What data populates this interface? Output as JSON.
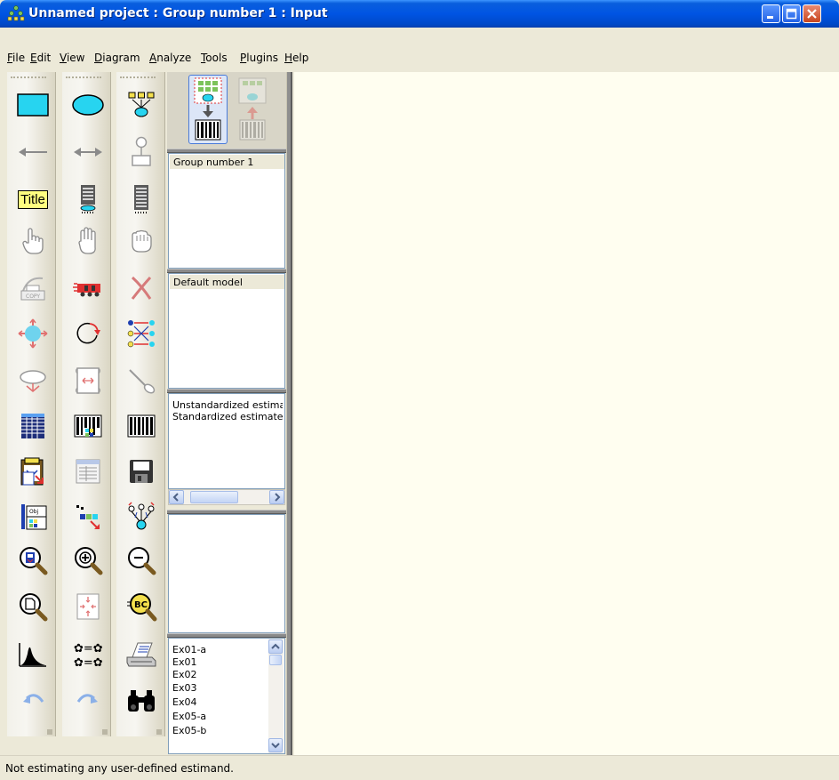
{
  "window": {
    "title": "Unnamed project : Group number 1 : Input",
    "controls": [
      "minimize",
      "maximize",
      "close"
    ]
  },
  "menu": [
    "File",
    "Edit",
    "View",
    "Diagram",
    "Analyze",
    "Tools",
    "Plugins",
    "Help"
  ],
  "toolbox": {
    "tools": [
      [
        "rectangle-icon",
        "ellipse-icon",
        "indicator-icon"
      ],
      [
        "single-arrow-icon",
        "double-arrow-icon",
        "unique-variable-icon"
      ],
      [
        "title-icon",
        "list-variables-model-icon",
        "list-variables-data-icon"
      ],
      [
        "select-one-icon",
        "select-all-icon",
        "deselect-all-icon"
      ],
      [
        "duplicate-icon",
        "move-icon",
        "erase-icon"
      ],
      [
        "change-shape-icon",
        "rotate-icon",
        "reflect-icon"
      ],
      [
        "move-parameters-icon",
        "scroll-icon",
        "touch-up-icon"
      ],
      [
        "data-files-icon",
        "analysis-properties-icon",
        "calculate-estimates-icon"
      ],
      [
        "copy-diagram-icon",
        "view-text-icon",
        "save-icon"
      ],
      [
        "object-properties-icon",
        "drag-properties-icon",
        "preserve-symmetries-icon"
      ],
      [
        "zoom-selected-icon",
        "zoom-in-icon",
        "zoom-out-icon"
      ],
      [
        "view-page-icon",
        "fit-to-page-icon",
        "magnifier-icon"
      ],
      [
        "bayesian-icon",
        "multiple-group-icon",
        "print-icon"
      ],
      [
        "undo-icon",
        "redo-icon",
        "specification-search-icon"
      ]
    ],
    "title_label": "Title"
  },
  "panel": {
    "view_input_label": "view input path diagram",
    "view_output_label": "view output path diagram",
    "groups": [
      "Group number 1"
    ],
    "models": [
      "Default model"
    ],
    "parameter_formats": [
      "Unstandardized estimates",
      "Standardized estimates"
    ],
    "files": [
      "Ex01-a",
      "Ex01",
      "Ex02",
      "Ex03",
      "Ex04",
      "Ex05-a",
      "Ex05-b"
    ]
  },
  "status": "Not estimating any user-defined estimand.",
  "colors": {
    "titlebar": "#0054E3",
    "canvas": "#FFFEF0",
    "rectangle": "#27D4F0",
    "title_bg": "#FFFF80"
  }
}
